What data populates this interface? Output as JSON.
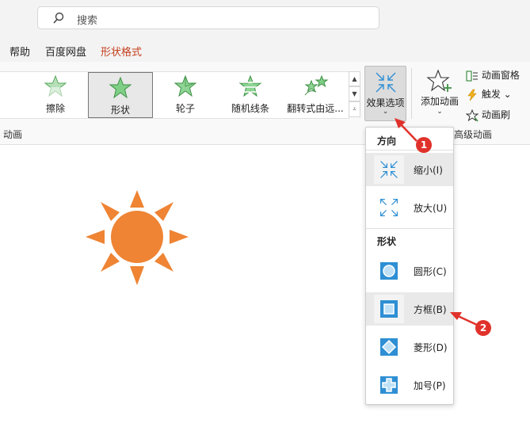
{
  "search": {
    "placeholder": "搜索"
  },
  "tabs": [
    {
      "label": "帮助"
    },
    {
      "label": "百度网盘"
    },
    {
      "label": "形状格式"
    }
  ],
  "animations": [
    {
      "label": "擦除"
    },
    {
      "label": "形状"
    },
    {
      "label": "轮子"
    },
    {
      "label": "随机线条"
    },
    {
      "label": "翻转式由远..."
    }
  ],
  "group_labels": {
    "animation": "动画",
    "advanced": "高级动画"
  },
  "effect_options": {
    "label": "效果选项"
  },
  "add_animation": {
    "label": "添加动画"
  },
  "advanced_buttons": [
    {
      "label": "动画窗格"
    },
    {
      "label": "触发 ⌄"
    },
    {
      "label": "动画刷"
    }
  ],
  "menu": {
    "direction_header": "方向",
    "direction_items": [
      {
        "label": "缩小(I)"
      },
      {
        "label": "放大(U)"
      }
    ],
    "shape_header": "形状",
    "shape_items": [
      {
        "label": "圆形(C)"
      },
      {
        "label": "方框(B)"
      },
      {
        "label": "菱形(D)"
      },
      {
        "label": "加号(P)"
      }
    ]
  },
  "callouts": [
    "1",
    "2"
  ],
  "colors": {
    "accent": "#c43e1c",
    "sun": "#ee8434",
    "callout": "#e0322b",
    "icon_blue": "#2e8fd4"
  }
}
